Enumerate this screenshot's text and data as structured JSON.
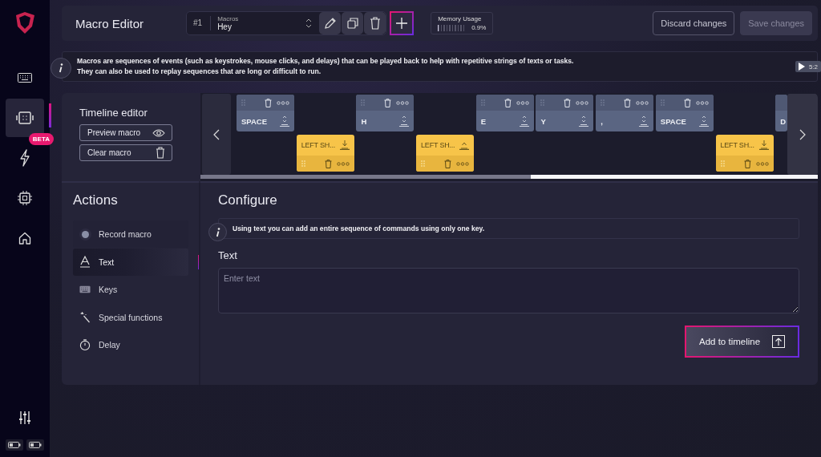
{
  "sidebar": {
    "items": [
      {
        "kind": "keyboard",
        "selected": false
      },
      {
        "kind": "macro",
        "selected": true
      },
      {
        "kind": "lightning",
        "selected": false,
        "badge": "BETA"
      },
      {
        "kind": "chip",
        "selected": false
      },
      {
        "kind": "home",
        "selected": false
      }
    ]
  },
  "header": {
    "title": "Macro Editor",
    "macro_number": "#1",
    "macro_select": {
      "label": "Macros",
      "value": "Hey"
    },
    "memory": {
      "label": "Memory Usage",
      "level": 0.009,
      "reading": "0.9%"
    },
    "buttons": [
      {
        "label": "Discard changes",
        "disabled": false
      },
      {
        "label": "Save changes",
        "disabled": true
      }
    ]
  },
  "info": {
    "lines": [
      "Macros are sequences of events (such as keystrokes, mouse clicks, and delays) that can be played back to help with repetitive strings of texts or tasks.",
      "They can also be used to replay sequences that are long or difficult to run."
    ]
  },
  "video_badge": {
    "time": "5:2"
  },
  "timeline": {
    "title": "Timeline editor",
    "buttons": [
      {
        "kind": "preview",
        "label": "Preview macro"
      },
      {
        "kind": "clear",
        "label": "Clear macro"
      }
    ],
    "events": [
      {
        "kind": "press",
        "label": "SPACE"
      },
      {
        "kind": "down",
        "label": "LEFT SH..."
      },
      {
        "kind": "press",
        "label": "H"
      },
      {
        "kind": "up",
        "label": "LEFT SH..."
      },
      {
        "kind": "press",
        "label": "E"
      },
      {
        "kind": "press",
        "label": "Y"
      },
      {
        "kind": "press",
        "label": ","
      },
      {
        "kind": "press",
        "label": "SPACE"
      },
      {
        "kind": "down",
        "label": "LEFT SH..."
      },
      {
        "kind": "press",
        "label": "D"
      }
    ]
  },
  "actions": {
    "title": "Actions",
    "items": [
      {
        "kind": "record",
        "label": "Record macro",
        "selected": false
      },
      {
        "kind": "text",
        "label": "Text",
        "selected": true
      },
      {
        "kind": "keys",
        "label": "Keys",
        "selected": false
      },
      {
        "kind": "special",
        "label": "Special functions",
        "selected": false
      },
      {
        "kind": "delay",
        "label": "Delay",
        "selected": false
      }
    ]
  },
  "configure": {
    "title": "Configure",
    "hint": "Using text you can add an entire sequence of commands using only one key.",
    "field": {
      "label": "Text",
      "placeholder": "Enter text"
    },
    "submit": "Add to timeline"
  }
}
